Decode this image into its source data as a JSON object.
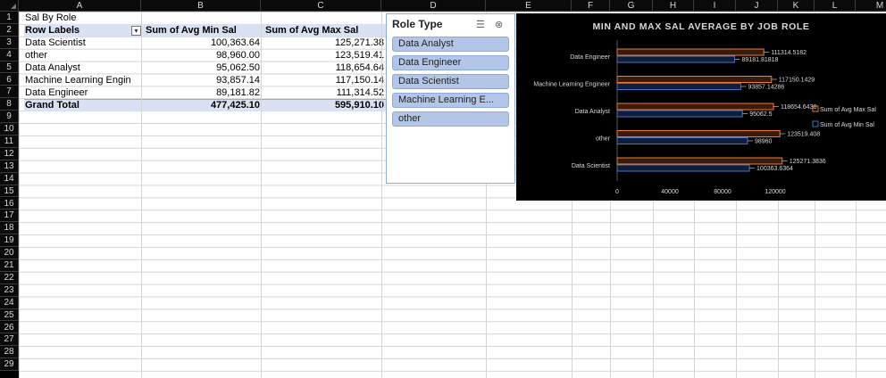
{
  "columns": [
    "A",
    "B",
    "C",
    "D",
    "E",
    "F",
    "G",
    "H",
    "I",
    "J",
    "K",
    "L",
    "M"
  ],
  "rows": [
    "1",
    "2",
    "3",
    "4",
    "5",
    "6",
    "7",
    "8",
    "9",
    "10",
    "11",
    "12",
    "13",
    "14",
    "15",
    "16",
    "17",
    "18",
    "19",
    "20",
    "21",
    "22",
    "23",
    "24",
    "25",
    "26",
    "27",
    "28",
    "29"
  ],
  "pivot": {
    "title": "Sal By Role",
    "headers": [
      "Row Labels",
      "Sum of Avg Min Sal",
      "Sum of Avg Max Sal"
    ],
    "rows": [
      {
        "label": "Data Scientist",
        "min": "100,363.64",
        "max": "125,271.38"
      },
      {
        "label": "other",
        "min": "98,960.00",
        "max": "123,519.41"
      },
      {
        "label": "Data Analyst",
        "min": "95,062.50",
        "max": "118,654.64"
      },
      {
        "label": "Machine Learning Engin",
        "min": "93,857.14",
        "max": "117,150.14"
      },
      {
        "label": "Data Engineer",
        "min": "89,181.82",
        "max": "111,314.52"
      }
    ],
    "total": {
      "label": "Grand Total",
      "min": "477,425.10",
      "max": "595,910.10"
    }
  },
  "slicer": {
    "title": "Role Type",
    "multiselect_icon": "multi-select-icon",
    "clear_icon": "clear-filter-icon",
    "items": [
      "Data Analyst",
      "Data Engineer",
      "Data Scientist",
      "Machine Learning E...",
      "other"
    ]
  },
  "chart_data": {
    "type": "bar",
    "title": "MIN AND MAX SAL AVERAGE BY JOB ROLE",
    "categories": [
      "Data Engineer",
      "Machine Learning Engineer",
      "Data Analyst",
      "other",
      "Data Scientist"
    ],
    "series": [
      {
        "name": "Sum of Avg Max Sal",
        "color": "#ed7d31",
        "values": [
          111314.5182,
          117150.1429,
          118654.6438,
          123519.408,
          125271.3836
        ],
        "labels": [
          "111314.5182",
          "117150.1429",
          "118654.6438",
          "123519.408",
          "125271.3836"
        ]
      },
      {
        "name": "Sum of Avg Min Sal",
        "color": "#4472c4",
        "values": [
          89181.81818,
          93857.14286,
          95062.5,
          98960,
          100363.6364
        ],
        "labels": [
          "89181.81818",
          "93857.14286",
          "95062.5",
          "98960",
          "100363.6364"
        ]
      }
    ],
    "xticks": [
      "0",
      "40000",
      "80000",
      "120000"
    ],
    "xlim": [
      0,
      120000
    ],
    "legend": "right"
  }
}
